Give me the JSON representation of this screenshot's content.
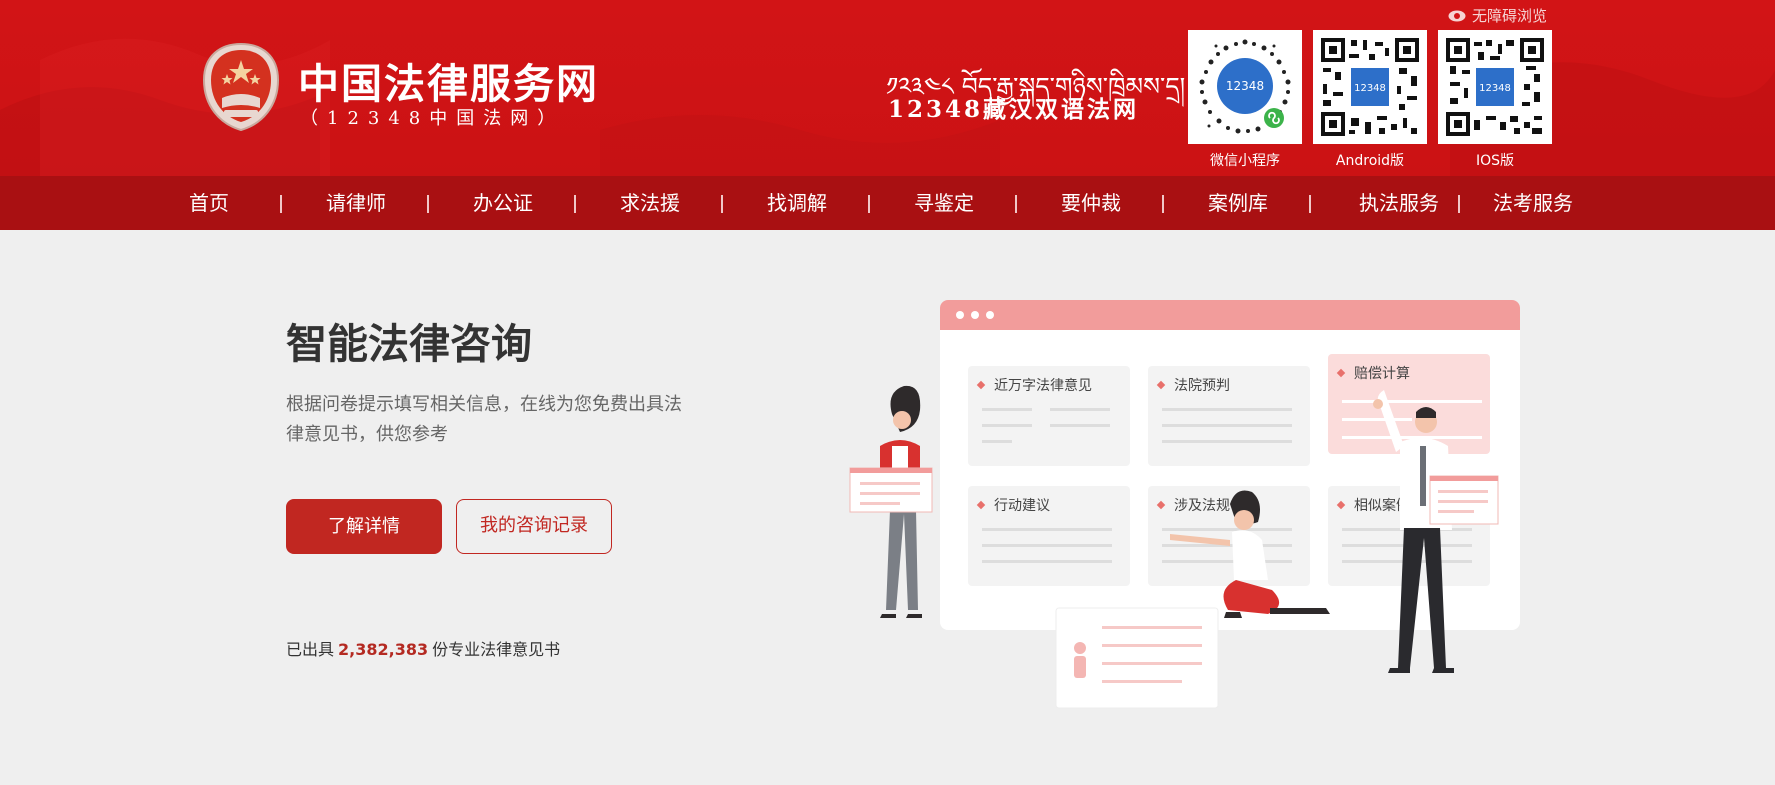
{
  "header": {
    "accessibility_label": "无障碍浏览",
    "site_title": "中国法律服务网",
    "site_subtitle": "（12348中国法网）",
    "tibetan_text": "༡༢༣༤༨ བོད་རྒྱ་སྐད་གཉིས་ཁྲིམས་དྲ།",
    "bilingual_title": "12348藏汉双语法网",
    "qr_codes": [
      {
        "label": "微信小程序",
        "badge": "12348"
      },
      {
        "label": "Android版",
        "badge": "12348"
      },
      {
        "label": "IOS版",
        "badge": "12348"
      }
    ],
    "colors": {
      "brand_red": "#d21416",
      "nav_red": "#a91012"
    }
  },
  "nav": {
    "items": [
      "首页",
      "请律师",
      "办公证",
      "求法援",
      "找调解",
      "寻鉴定",
      "要仲裁",
      "案例库",
      "执法服务",
      "法考服务"
    ]
  },
  "main": {
    "title": "智能法律咨询",
    "description": "根据问卷提示填写相关信息，在线为您免费出具法律意见书，供您参考",
    "primary_button": "了解详情",
    "secondary_button": "我的咨询记录",
    "stats_prefix": "已出具",
    "stats_count": "2,382,383",
    "stats_suffix": "份专业法律意见书",
    "accent_color": "#c12721"
  },
  "illustration": {
    "cards": [
      "近万字法律意见",
      "法院预判",
      "赔偿计算",
      "行动建议",
      "涉及法规",
      "相似案例"
    ]
  }
}
